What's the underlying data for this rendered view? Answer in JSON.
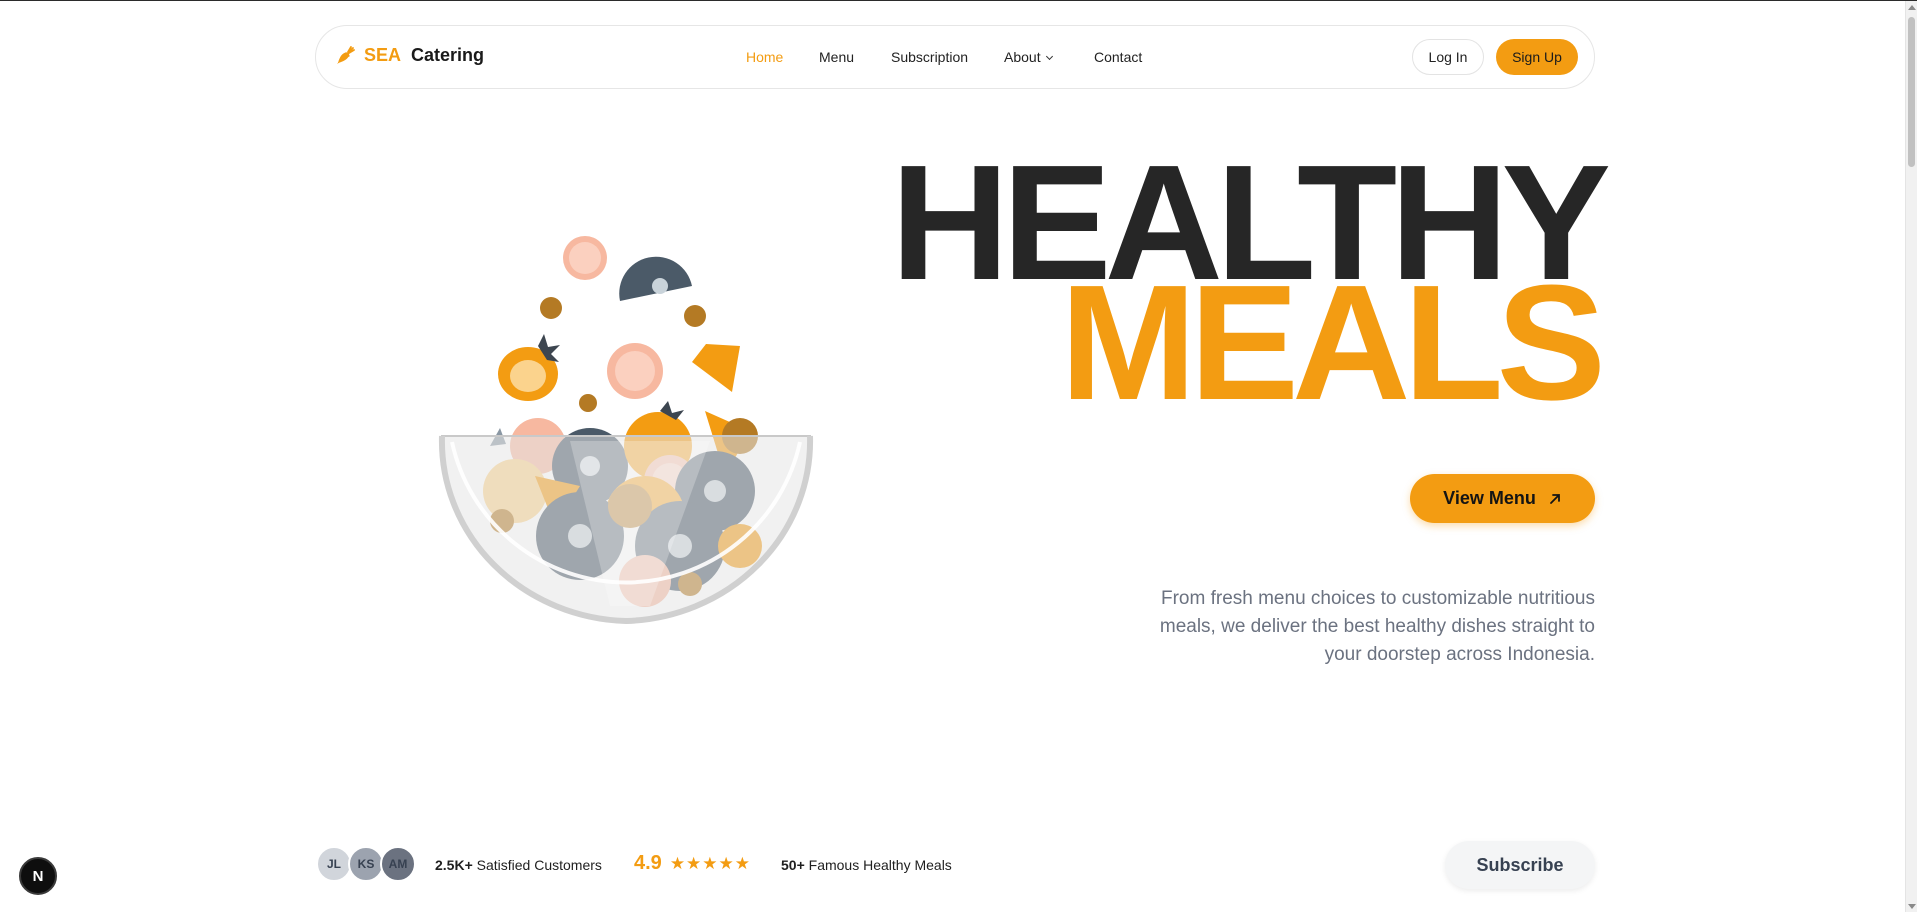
{
  "brand": {
    "accent": "SEA",
    "name": "Catering",
    "logo_icon": "carrot-icon"
  },
  "nav": {
    "links": [
      {
        "label": "Home",
        "active": true
      },
      {
        "label": "Menu",
        "active": false
      },
      {
        "label": "Subscription",
        "active": false
      },
      {
        "label": "About",
        "active": false,
        "has_dropdown": true
      },
      {
        "label": "Contact",
        "active": false
      }
    ],
    "login_label": "Log In",
    "signup_label": "Sign Up"
  },
  "hero": {
    "title_line1": "HEALTHY",
    "title_line2": "MEALS",
    "cta_label": "View Menu",
    "cta_icon": "arrow-up-right-icon",
    "description": "From fresh menu choices to customizable nutritious meals, we deliver the best healthy dishes straight to your doorstep across Indonesia."
  },
  "stats": {
    "avatars": [
      "JL",
      "KS",
      "AM"
    ],
    "customers_count": "2.5K+",
    "customers_label": "Satisfied Customers",
    "rating_value": "4.9",
    "rating_stars": "★★★★★",
    "meals_count": "50+",
    "meals_label": "Famous Healthy Meals"
  },
  "subscribe_label": "Subscribe",
  "dev_badge": "N",
  "colors": {
    "accent": "#f39c12",
    "dark": "#262626",
    "muted": "#6b7280"
  }
}
